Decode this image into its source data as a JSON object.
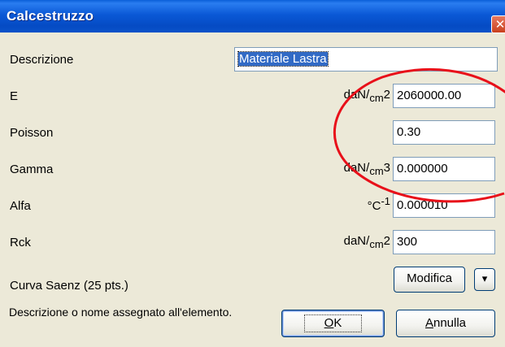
{
  "window": {
    "title": "Calcestruzzo",
    "close_glyph": "✕"
  },
  "fields": [
    {
      "label": "Descrizione",
      "unit_main": "",
      "unit_small": "",
      "unit_suffix": "",
      "value": "Materiale Lastra",
      "selected": true
    },
    {
      "label": "E",
      "unit_main": "daN/",
      "unit_small": "cm",
      "unit_suffix": "2",
      "value": "2060000.00"
    },
    {
      "label": "Poisson",
      "unit_main": "",
      "unit_small": "",
      "unit_suffix": "",
      "value": "0.30"
    },
    {
      "label": "Gamma",
      "unit_main": "daN/",
      "unit_small": "cm",
      "unit_suffix": "3",
      "value": "0.000000"
    },
    {
      "label": "Alfa",
      "unit_main": "°C",
      "unit_small": "",
      "unit_suffix": "-1",
      "value": "0.000010"
    },
    {
      "label": "Rck",
      "unit_main": "daN/",
      "unit_small": "cm",
      "unit_suffix": "2",
      "value": "300"
    }
  ],
  "curve": {
    "label": "Curva Saenz (25 pts.)",
    "modify_label": "Modifica",
    "dropdown_glyph": "▾"
  },
  "help_text": "Descrizione o nome assegnato all'elemento.",
  "buttons": {
    "ok_label": "OK",
    "ok_mnemonic": "O",
    "ok_rest": "K",
    "cancel_label": "Annulla",
    "cancel_mnemonic": "A",
    "cancel_rest": "nnulla"
  },
  "annotation": {
    "color": "#e8101a"
  }
}
